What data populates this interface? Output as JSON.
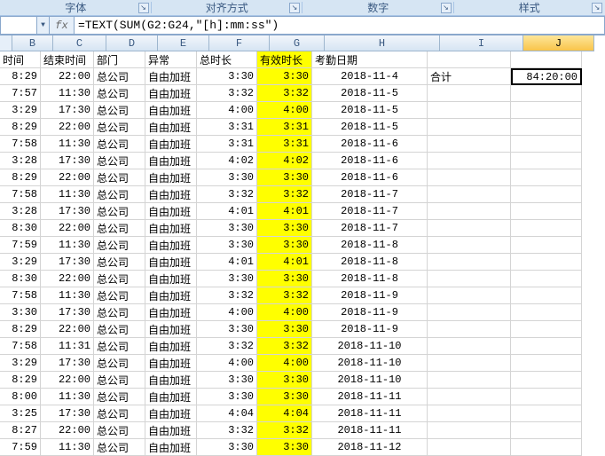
{
  "ribbon": {
    "groups": [
      "字体",
      "对齐方式",
      "数字",
      "样式"
    ]
  },
  "formula_bar": {
    "name_box": "",
    "fx": "fx",
    "formula": "=TEXT(SUM(G2:G24,\"[h]:mm:ss\")"
  },
  "columns": [
    {
      "letter": "B",
      "cls": "w-b"
    },
    {
      "letter": "C",
      "cls": "w-c"
    },
    {
      "letter": "D",
      "cls": "w-d"
    },
    {
      "letter": "E",
      "cls": "w-e"
    },
    {
      "letter": "F",
      "cls": "w-f"
    },
    {
      "letter": "G",
      "cls": "w-g"
    },
    {
      "letter": "H",
      "cls": "w-h"
    },
    {
      "letter": "I",
      "cls": "w-i"
    },
    {
      "letter": "J",
      "cls": "w-j",
      "active": true
    }
  ],
  "headers": {
    "b": "时间",
    "c": "结束时间",
    "d": "部门",
    "e": "异常",
    "f": "总时长",
    "g": "有效时长",
    "h": "考勤日期",
    "i": "",
    "j": ""
  },
  "summary": {
    "label": "合计",
    "value": "84:20:00"
  },
  "rows": [
    {
      "b": "8:29",
      "c": "22:00",
      "d": "总公司",
      "e": "自由加班",
      "f": "3:30",
      "g": "3:30",
      "h": "2018-11-4"
    },
    {
      "b": "7:57",
      "c": "11:30",
      "d": "总公司",
      "e": "自由加班",
      "f": "3:32",
      "g": "3:32",
      "h": "2018-11-5"
    },
    {
      "b": "3:29",
      "c": "17:30",
      "d": "总公司",
      "e": "自由加班",
      "f": "4:00",
      "g": "4:00",
      "h": "2018-11-5"
    },
    {
      "b": "8:29",
      "c": "22:00",
      "d": "总公司",
      "e": "自由加班",
      "f": "3:31",
      "g": "3:31",
      "h": "2018-11-5"
    },
    {
      "b": "7:58",
      "c": "11:30",
      "d": "总公司",
      "e": "自由加班",
      "f": "3:31",
      "g": "3:31",
      "h": "2018-11-6"
    },
    {
      "b": "3:28",
      "c": "17:30",
      "d": "总公司",
      "e": "自由加班",
      "f": "4:02",
      "g": "4:02",
      "h": "2018-11-6"
    },
    {
      "b": "8:29",
      "c": "22:00",
      "d": "总公司",
      "e": "自由加班",
      "f": "3:30",
      "g": "3:30",
      "h": "2018-11-6"
    },
    {
      "b": "7:58",
      "c": "11:30",
      "d": "总公司",
      "e": "自由加班",
      "f": "3:32",
      "g": "3:32",
      "h": "2018-11-7"
    },
    {
      "b": "3:28",
      "c": "17:30",
      "d": "总公司",
      "e": "自由加班",
      "f": "4:01",
      "g": "4:01",
      "h": "2018-11-7"
    },
    {
      "b": "8:30",
      "c": "22:00",
      "d": "总公司",
      "e": "自由加班",
      "f": "3:30",
      "g": "3:30",
      "h": "2018-11-7"
    },
    {
      "b": "7:59",
      "c": "11:30",
      "d": "总公司",
      "e": "自由加班",
      "f": "3:30",
      "g": "3:30",
      "h": "2018-11-8"
    },
    {
      "b": "3:29",
      "c": "17:30",
      "d": "总公司",
      "e": "自由加班",
      "f": "4:01",
      "g": "4:01",
      "h": "2018-11-8"
    },
    {
      "b": "8:30",
      "c": "22:00",
      "d": "总公司",
      "e": "自由加班",
      "f": "3:30",
      "g": "3:30",
      "h": "2018-11-8"
    },
    {
      "b": "7:58",
      "c": "11:30",
      "d": "总公司",
      "e": "自由加班",
      "f": "3:32",
      "g": "3:32",
      "h": "2018-11-9"
    },
    {
      "b": "3:30",
      "c": "17:30",
      "d": "总公司",
      "e": "自由加班",
      "f": "4:00",
      "g": "4:00",
      "h": "2018-11-9"
    },
    {
      "b": "8:29",
      "c": "22:00",
      "d": "总公司",
      "e": "自由加班",
      "f": "3:30",
      "g": "3:30",
      "h": "2018-11-9"
    },
    {
      "b": "7:58",
      "c": "11:31",
      "d": "总公司",
      "e": "自由加班",
      "f": "3:32",
      "g": "3:32",
      "h": "2018-11-10"
    },
    {
      "b": "3:29",
      "c": "17:30",
      "d": "总公司",
      "e": "自由加班",
      "f": "4:00",
      "g": "4:00",
      "h": "2018-11-10"
    },
    {
      "b": "8:29",
      "c": "22:00",
      "d": "总公司",
      "e": "自由加班",
      "f": "3:30",
      "g": "3:30",
      "h": "2018-11-10"
    },
    {
      "b": "8:00",
      "c": "11:30",
      "d": "总公司",
      "e": "自由加班",
      "f": "3:30",
      "g": "3:30",
      "h": "2018-11-11"
    },
    {
      "b": "3:25",
      "c": "17:30",
      "d": "总公司",
      "e": "自由加班",
      "f": "4:04",
      "g": "4:04",
      "h": "2018-11-11"
    },
    {
      "b": "8:27",
      "c": "22:00",
      "d": "总公司",
      "e": "自由加班",
      "f": "3:32",
      "g": "3:32",
      "h": "2018-11-11"
    },
    {
      "b": "7:59",
      "c": "11:30",
      "d": "总公司",
      "e": "自由加班",
      "f": "3:30",
      "g": "3:30",
      "h": "2018-11-12"
    }
  ]
}
